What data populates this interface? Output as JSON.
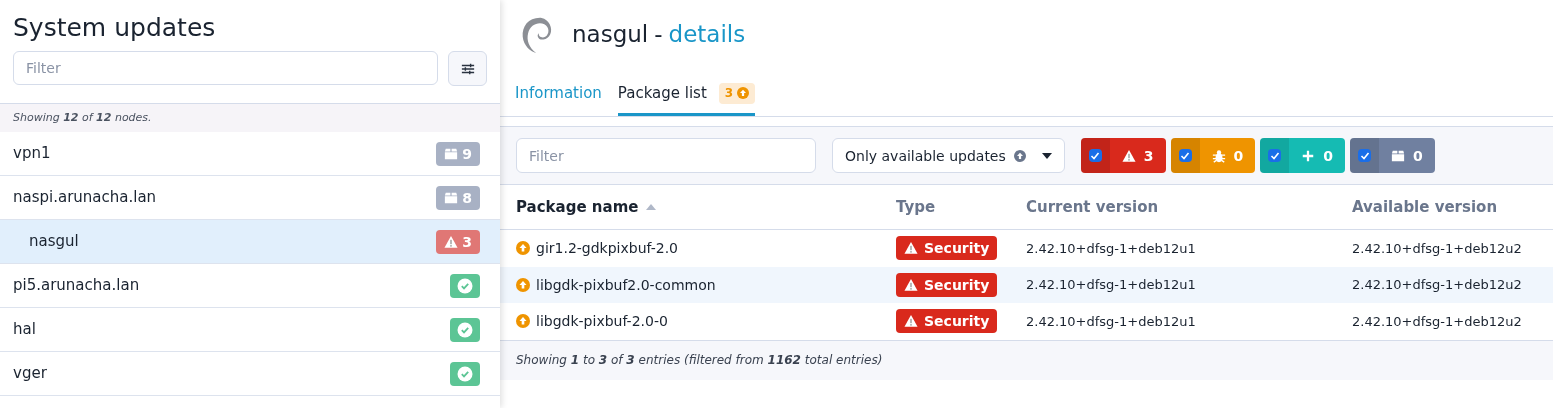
{
  "sidebar": {
    "title": "System updates",
    "filter": {
      "placeholder": "Filter"
    },
    "summary": "Showing **12** of **12** nodes.",
    "nodes": [
      {
        "name": "vpn1",
        "selected": false,
        "badge": {
          "kind": "packages",
          "count": "9"
        }
      },
      {
        "name": "naspi.arunacha.lan",
        "selected": false,
        "badge": {
          "kind": "packages",
          "count": "8"
        },
        "children": [
          {
            "name": "nasgul",
            "selected": true,
            "badge": {
              "kind": "security",
              "count": "3"
            }
          }
        ]
      },
      {
        "name": "pi5.arunacha.lan",
        "selected": false,
        "badge": {
          "kind": "ok"
        }
      },
      {
        "name": "hal",
        "selected": false,
        "badge": {
          "kind": "ok"
        }
      },
      {
        "name": "vger",
        "selected": false,
        "badge": {
          "kind": "ok"
        }
      }
    ]
  },
  "details": {
    "host": "nasgul",
    "separator": "-",
    "subtitle": "details",
    "tabs": [
      {
        "label": "Information",
        "selected": false
      },
      {
        "label": "Package list",
        "selected": true,
        "badge": "3"
      }
    ],
    "filter": {
      "placeholder": "Filter"
    },
    "update_filter": "Only available updates",
    "toggles": [
      {
        "kind": "security",
        "checked": true,
        "count": "3",
        "color": "#d9291c"
      },
      {
        "kind": "bugfix",
        "checked": true,
        "count": "0",
        "color": "#ef9400"
      },
      {
        "kind": "feature",
        "checked": true,
        "count": "0",
        "color": "#15bbb3"
      },
      {
        "kind": "package",
        "checked": true,
        "count": "0",
        "color": "#7080a0"
      }
    ],
    "table": {
      "columns": [
        {
          "label": "Package name",
          "sorted": true
        },
        {
          "label": "Type",
          "sorted": false
        },
        {
          "label": "Current version",
          "sorted": false
        },
        {
          "label": "Available version",
          "sorted": false
        }
      ],
      "rows": [
        {
          "name": "gir1.2-gdkpixbuf-2.0",
          "type": {
            "kind": "security",
            "label": "Security"
          },
          "current": "2.42.10+dfsg-1+deb12u1",
          "available": "2.42.10+dfsg-1+deb12u2"
        },
        {
          "name": "libgdk-pixbuf2.0-common",
          "type": {
            "kind": "security",
            "label": "Security"
          },
          "current": "2.42.10+dfsg-1+deb12u1",
          "available": "2.42.10+dfsg-1+deb12u2"
        },
        {
          "name": "libgdk-pixbuf-2.0-0",
          "type": {
            "kind": "security",
            "label": "Security"
          },
          "current": "2.42.10+dfsg-1+deb12u1",
          "available": "2.42.10+dfsg-1+deb12u2"
        }
      ],
      "footer": "Showing **1** to **3** of **3** entries (filtered from **1162** total entries)"
    }
  }
}
